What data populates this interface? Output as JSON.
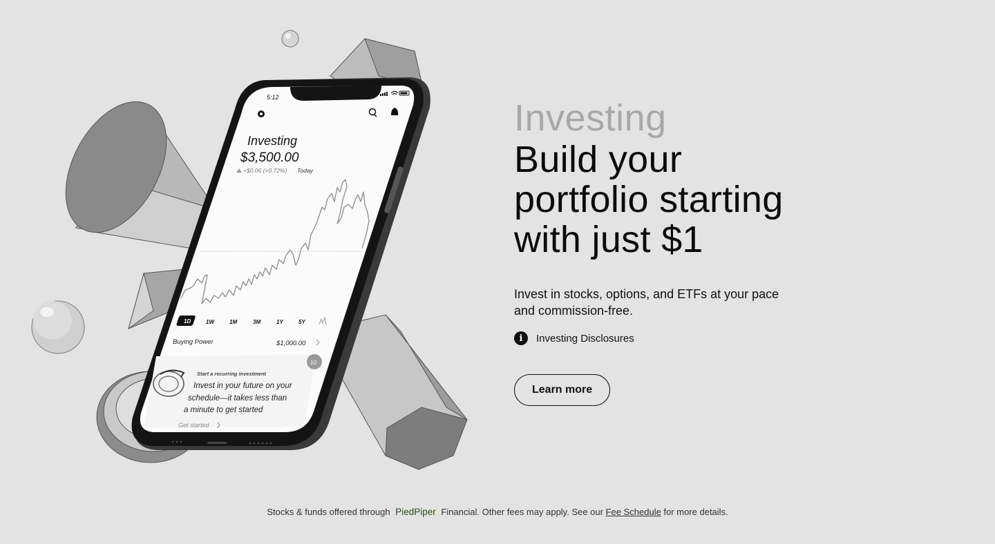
{
  "phone": {
    "time": "5:12",
    "title": "Investing",
    "balance": "$3,500.00",
    "change": "+$0.06 (+0.72%)",
    "change_period": "Today",
    "ranges": [
      "1D",
      "1W",
      "1M",
      "3M",
      "1Y",
      "5Y"
    ],
    "buying_power_label": "Buying Power",
    "buying_power_value": "$1,000.00",
    "card_badge": "10",
    "card_eyebrow": "Start a recurring investment",
    "card_line1": "Invest in your future on your",
    "card_line2": "schedule—it takes less than",
    "card_line3": "a minute to get started",
    "card_cta": "Get started"
  },
  "hero": {
    "eyebrow": "Investing",
    "headline_line1": "Build your",
    "headline_line2": "portfolio starting",
    "headline_line3": "with just $1",
    "subtext": "Invest in stocks, options, and ETFs at your pace and commission-free.",
    "disclosure_label": "Investing Disclosures",
    "cta_label": "Learn more"
  },
  "footer": {
    "prefix": "Stocks & funds offered through",
    "brand": "PiedPiper",
    "middle": "Financial. Other fees may apply. See our",
    "link": "Fee Schedule",
    "suffix": "for more details."
  },
  "colors": {
    "background": "#e3e3e3",
    "eyebrow": "#a8a8a8",
    "brand": "#2e4c1c"
  }
}
